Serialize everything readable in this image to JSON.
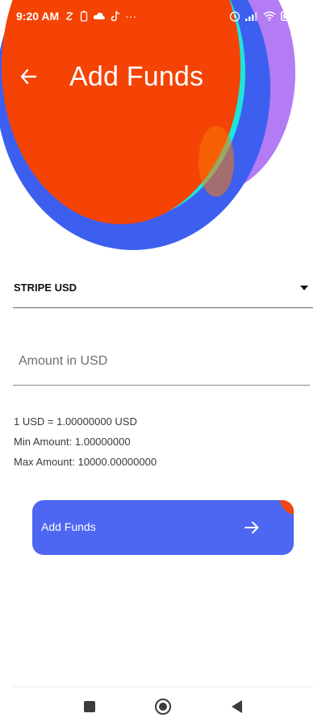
{
  "status_bar": {
    "time": "9:20 AM",
    "more_indicator": "···",
    "left_icons": [
      "nfc-icon",
      "battery-saver-icon",
      "cloud-icon",
      "tiktok-icon"
    ],
    "right_icons": [
      "alarm-icon",
      "signal-icon",
      "wifi-icon",
      "battery-icon",
      "charging-icon"
    ]
  },
  "header": {
    "title": "Add Funds",
    "back_icon": "arrow-left-icon"
  },
  "form": {
    "gateway": {
      "selected": "STRIPE USD",
      "icon": "dropdown-arrow-icon"
    },
    "amount": {
      "placeholder": "Amount in USD",
      "value": ""
    },
    "info": {
      "rate": "1 USD = 1.00000000 USD",
      "min": "Min Amount: 1.00000000",
      "max": "Max Amount: 10000.00000000"
    },
    "submit": {
      "label": "Add Funds",
      "icon": "arrow-right-icon"
    }
  },
  "nav_bar": {
    "icons": [
      "recents-square-icon",
      "home-circle-icon",
      "back-triangle-icon"
    ]
  },
  "colors": {
    "hero_orange": "#f44304",
    "hero_blue": "#3d5ff0",
    "hero_purple": "#b47cf4",
    "hero_teal": "#1de6d8",
    "button_blue": "#4d67f2",
    "button_blob_orange": "#f04812",
    "button_blob_teal": "#36dbc0"
  }
}
